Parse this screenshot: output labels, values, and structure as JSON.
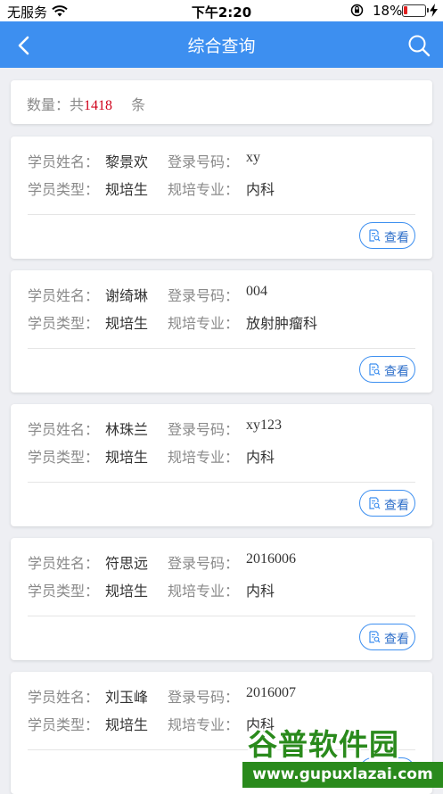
{
  "status_bar": {
    "carrier": "无服务",
    "time": "下午2:20",
    "battery_pct": "18%",
    "battery_level": 0.18,
    "icons": [
      "wifi-icon",
      "orientation-lock-icon",
      "battery-icon",
      "charging-icon"
    ]
  },
  "nav": {
    "title": "综合查询",
    "back_icon": "chevron-left-icon",
    "search_icon": "search-icon",
    "color": "#3d8ff0"
  },
  "count": {
    "label": "数量：共",
    "value": "1418",
    "unit": "条",
    "value_color": "#d0021b"
  },
  "labels": {
    "name": "学员姓名：",
    "login": "登录号码：",
    "type": "学员类型：",
    "major": "规培专业：",
    "view": "查看"
  },
  "students": [
    {
      "name": "黎景欢",
      "login": "xy",
      "type": "规培生",
      "major": "内科"
    },
    {
      "name": "谢绮琳",
      "login": "004",
      "type": "规培生",
      "major": "放射肿瘤科"
    },
    {
      "name": "林珠兰",
      "login": "xy123",
      "type": "规培生",
      "major": "内科"
    },
    {
      "name": "符思远",
      "login": "2016006",
      "type": "规培生",
      "major": "内科"
    },
    {
      "name": "刘玉峰",
      "login": "2016007",
      "type": "规培生",
      "major": "内科"
    }
  ],
  "watermark": {
    "text": "谷普软件园",
    "url": "www.gupuxlazai.com"
  }
}
